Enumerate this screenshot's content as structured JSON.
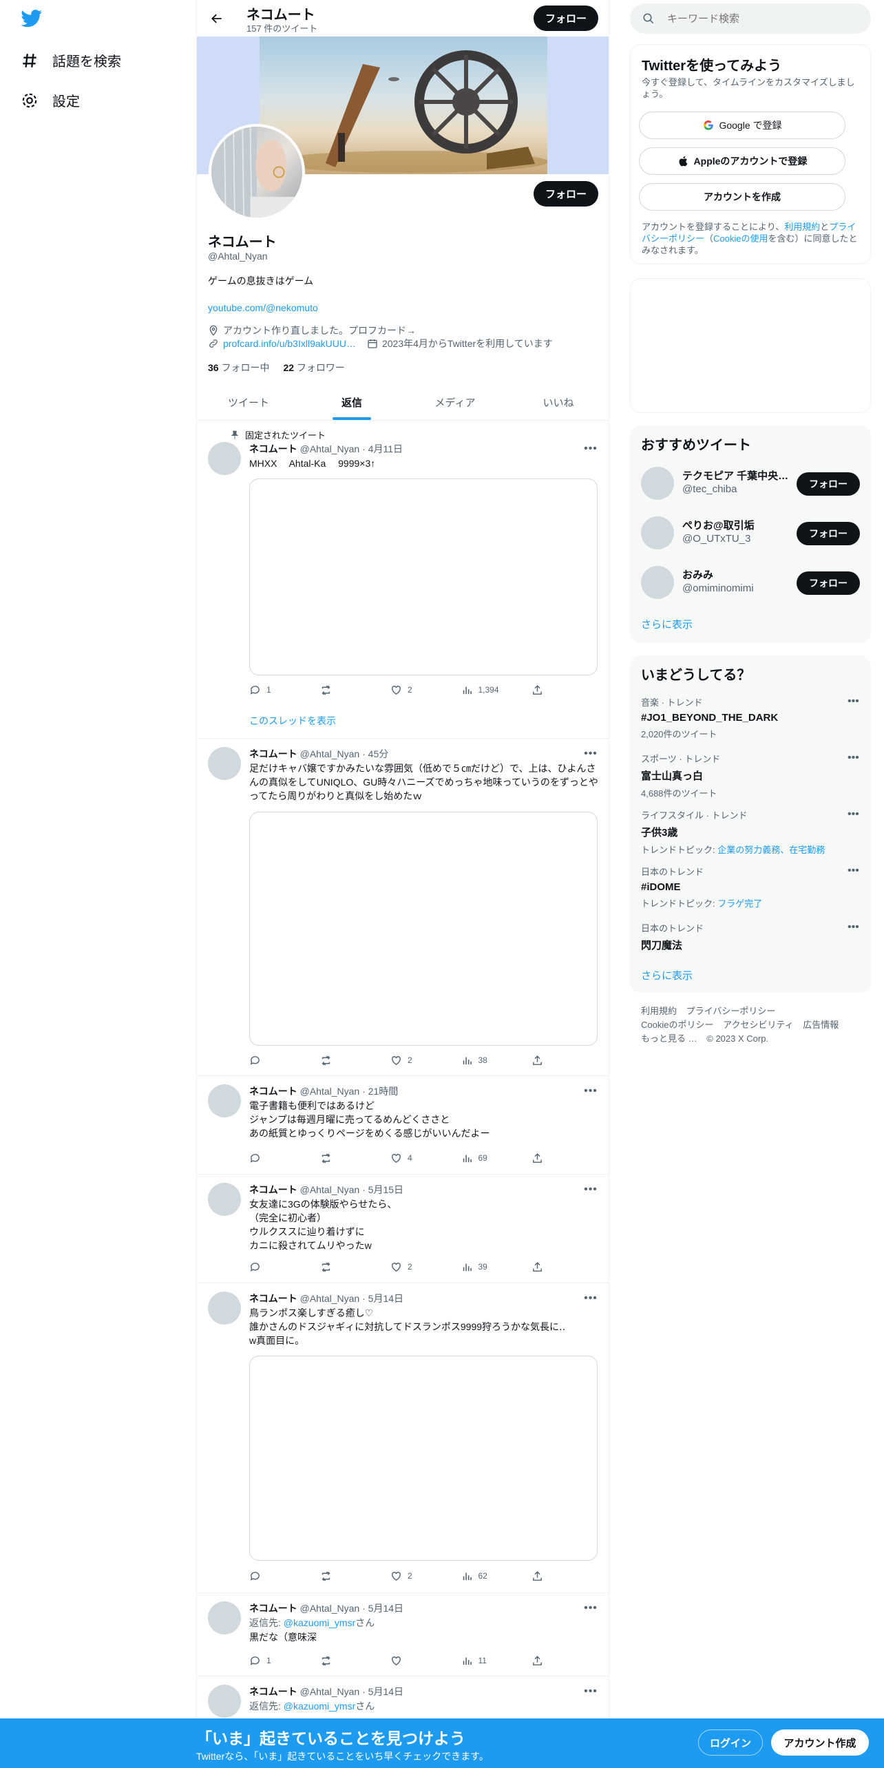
{
  "nav": {
    "explore_label": "話題を検索",
    "settings_label": "設定"
  },
  "profile": {
    "header_name": "ネコムート",
    "tweet_count": "157 件のツイート",
    "follow_label": "フォロー",
    "name": "ネコムート",
    "handle": "@Ahtal_Nyan",
    "bio": "ゲームの息抜きはゲーム",
    "link": "youtube.com/@nekomuto",
    "location": "アカウント作り直しました。プロフカード→",
    "url": "profcard.info/u/b3Ixll9akUUU…",
    "joined": "2023年4月からTwitterを利用しています",
    "following_count": "36",
    "following_label": "フォロー中",
    "followers_count": "22",
    "followers_label": "フォロワー"
  },
  "tabs": [
    "ツイート",
    "返信",
    "メディア",
    "いいね"
  ],
  "pinned_label": "固定されたツイート",
  "thread_label": "このスレッドを表示",
  "tweets": [
    {
      "name": "ネコムート",
      "meta": "@Ahtal_Nyan · 4月11日",
      "text": "MHXX　 Ahtal-Ka　 9999×3↑",
      "reply": "1",
      "like": "2",
      "views": "1,394"
    },
    {
      "name": "ネコムート",
      "meta": "@Ahtal_Nyan · 45分",
      "text": "足だけキャバ嬢ですかみたいな雰囲気（低めで５㎝だけど）で、上は、ひよんさんの真似をしてUNIQLO、GU時々ハニーズでめっちゃ地味っていうのをずっとやってたら周りがわりと真似をし始めたｗ",
      "reply": "",
      "like": "2",
      "views": "38"
    },
    {
      "name": "ネコムート",
      "meta": "@Ahtal_Nyan · 21時間",
      "text": "電子書籍も便利ではあるけど\nジャンプは毎週月曜に売ってるめんどくささと\nあの紙質とゆっくりページをめくる感じがいいんだよー",
      "reply": "",
      "like": "4",
      "views": "69"
    },
    {
      "name": "ネコムート",
      "meta": "@Ahtal_Nyan · 5月15日",
      "text": "女友達に3Gの体験版やらせたら、\n（完全に初心者）\nウルクススに辿り着けずに\nカニに殺されてムリやったw",
      "reply": "",
      "like": "2",
      "views": "39"
    },
    {
      "name": "ネコムート",
      "meta": "@Ahtal_Nyan · 5月14日",
      "text": "鳥ランポス楽しすぎる癒し♡\n誰かさんのドスジャギィに対抗してドスランポス9999狩ろうかな気長に‥\nw真面目に。",
      "reply": "",
      "like": "2",
      "views": "62"
    },
    {
      "name": "ネコムート",
      "meta": "@Ahtal_Nyan · 5月14日",
      "reply_prefix": "返信先: ",
      "reply_to": "@kazuomi_ymsr",
      "reply_suffix": "さん",
      "text": "黒だな（意味深",
      "reply": "1",
      "like": "",
      "views": "11"
    },
    {
      "name": "ネコムート",
      "meta": "@Ahtal_Nyan · 5月14日",
      "reply_prefix": "返信先: ",
      "reply_to": "@kazuomi_ymsr",
      "reply_suffix": "さん"
    }
  ],
  "search": {
    "placeholder": "キーワード検索"
  },
  "signup": {
    "title": "Twitterを使ってみよう",
    "subtitle": "今すぐ登録して、タイムラインをカスタマイズしましょう。",
    "google": "Google で登録",
    "apple": "Appleのアカウントで登録",
    "create": "アカウントを作成",
    "legal_1": "アカウントを登録することにより、",
    "legal_terms": "利用規約",
    "legal_2": "と",
    "legal_privacy": "プライバシーポリシー",
    "legal_3": "（",
    "legal_cookie": "Cookieの使用",
    "legal_4": "を含む）に同意したとみなされます。"
  },
  "who": {
    "title": "おすすめツイート",
    "users": [
      {
        "name": "テクモピア 千葉中央店【公式】",
        "handle": "@tec_chiba"
      },
      {
        "name": "ぺりお@取引垢",
        "handle": "@O_UTxTU_3"
      },
      {
        "name": "おみみ",
        "handle": "@omiminomimi"
      }
    ],
    "follow_label": "フォロー",
    "more": "さらに表示"
  },
  "trends": {
    "title": "いまどうしてる？",
    "items": [
      {
        "ctx": "音楽 · トレンド",
        "name": "#JO1_BEYOND_THE_DARK",
        "sub": "2,020件のツイート"
      },
      {
        "ctx": "スポーツ · トレンド",
        "name": "富士山真っ白",
        "sub": "4,688件のツイート"
      },
      {
        "ctx": "ライフスタイル · トレンド",
        "name": "子供3歳",
        "sub_prefix": "トレンドトピック: ",
        "sub_link": "企業の努力義務、在宅勤務"
      },
      {
        "ctx": "日本のトレンド",
        "name": "#iDOME",
        "sub_prefix": "トレンドトピック: ",
        "sub_link": "フラゲ完了"
      },
      {
        "ctx": "日本のトレンド",
        "name": "閃刀魔法"
      }
    ],
    "more": "さらに表示"
  },
  "footer": {
    "links": [
      "利用規約",
      "プライバシーポリシー",
      "Cookieのポリシー",
      "アクセシビリティ",
      "広告情報",
      "もっと見る …",
      "© 2023 X Corp."
    ]
  },
  "bottom": {
    "title": "「いま」起きていることを見つけよう",
    "subtitle": "Twitterなら、「いま」起きていることをいち早くチェックできます。",
    "login": "ログイン",
    "signup": "アカウント作成"
  },
  "colors": {
    "accent": "#1d9bf0",
    "text": "#0f1419",
    "muted": "#536471"
  }
}
